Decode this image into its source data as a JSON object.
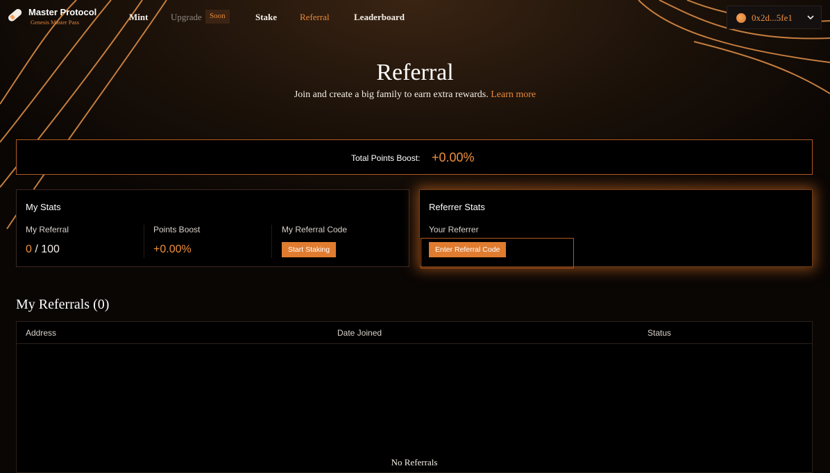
{
  "brand": {
    "title": "Master Protocol",
    "subtitle": "Genesis Master Pass",
    "accent_color": "#E8843A"
  },
  "nav": {
    "items": [
      {
        "label": "Mint",
        "state": "default"
      },
      {
        "label": "Upgrade",
        "state": "disabled",
        "badge": "Soon"
      },
      {
        "label": "Stake",
        "state": "default"
      },
      {
        "label": "Referral",
        "state": "active"
      },
      {
        "label": "Leaderboard",
        "state": "default"
      }
    ]
  },
  "wallet": {
    "address": "0x2d...5fe1",
    "icon": "chevron-down-icon"
  },
  "header": {
    "title": "Referral",
    "subtitle_text": "Join and create a big family to earn extra rewards.",
    "learn_more": "Learn more"
  },
  "total_boost": {
    "label": "Total Points Boost:",
    "value": "+0.00%"
  },
  "my_stats": {
    "title": "My Stats",
    "referral_label": "My Referral",
    "referral_count": "0",
    "referral_max": "/ 100",
    "boost_label": "Points Boost",
    "boost_value": "+0.00%",
    "code_label": "My Referral Code",
    "code_button": "Start Staking"
  },
  "referrer_stats": {
    "title": "Referrer Stats",
    "referrer_label": "Your Referrer",
    "enter_button": "Enter Referral Code"
  },
  "referrals": {
    "title": "My Referrals (0)",
    "columns": [
      "Address",
      "Date Joined",
      "Status"
    ],
    "rows": [],
    "empty_text": "No Referrals"
  }
}
